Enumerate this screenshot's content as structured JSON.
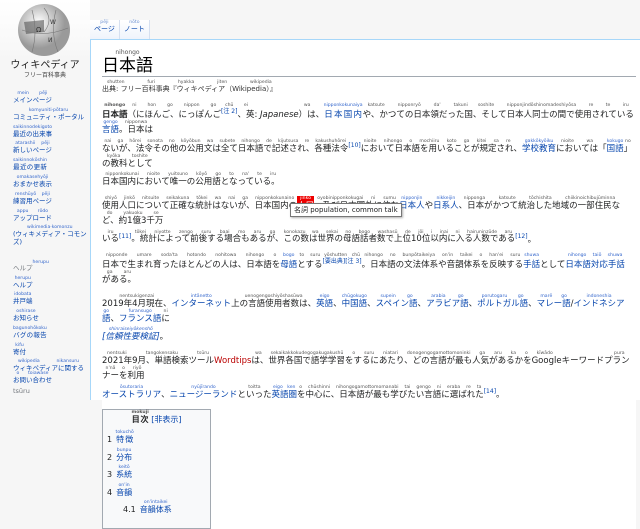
{
  "sidebar": {
    "logo_title": "ウィキペディア",
    "logo_sub": "フリー百科事典",
    "nav": [
      {
        "t": "メインページ",
        "r": "mein pēji"
      },
      {
        "t": "コミュニティ・ポータル",
        "r": "komyuniti·pōtaru"
      },
      {
        "t": "最近の出来事",
        "r": "saikinnodekigoto"
      },
      {
        "t": "新しいページ",
        "r": "atarashii pēji"
      },
      {
        "t": "最近の更新",
        "r": "saikinnokōshin"
      },
      {
        "t": "おまかせ表示",
        "r": "omakasehyōji"
      },
      {
        "t": "練習用ページ",
        "r": "renshūyō pēji"
      },
      {
        "t": "アップロード",
        "r": "appu rōdo"
      },
      {
        "t": "(ウィキメディア・コモンズ)",
        "r": "wikimedia·komonzu"
      }
    ],
    "help_heading": {
      "t": "ヘルプ",
      "r": "herupu"
    },
    "help": [
      {
        "t": "ヘルプ",
        "r": "herupu"
      },
      {
        "t": "井戸端",
        "r": "idobata"
      },
      {
        "t": "お知らせ",
        "r": "oshirase"
      },
      {
        "t": "バグの報告",
        "r": "bagunohōkoku"
      },
      {
        "t": "寄付",
        "r": "kifu"
      },
      {
        "t": "ウィキペディアに関するお問い合わせ",
        "r": "wikipedia nikansuru o toiawase"
      }
    ],
    "tools_heading": "tsūru"
  },
  "tabs": [
    {
      "t": "ページ",
      "r": "pēji"
    },
    {
      "t": "ノート",
      "r": "nōto"
    }
  ],
  "title": {
    "t": "日本語",
    "r": "nihongo"
  },
  "site_sub": [
    {
      "t": "出典: フリー百科事典『ウィキペディア（Wikipedia）』",
      "r": "shutten furi hyakka jiten wikipedia"
    }
  ],
  "paragraphs": [
    [
      [
        {
          "t": "日本語",
          "r": "nihongo",
          "c": "b"
        },
        {
          "t": "（にほんご、にっぽんご",
          "r": "ni hon go  nippon go"
        },
        {
          "t": "[注 2]",
          "r": "chū",
          "c": "s"
        },
        {
          "t": "、英",
          "r": "ei"
        },
        {
          "t": ": "
        },
        {
          "t": "Japanese",
          "c": "i"
        },
        {
          "t": "）は",
          "r": "wa"
        },
        {
          "t": "、"
        },
        {
          "t": "日本国内",
          "r": "nipponkokunaiya",
          "c": "l"
        },
        {
          "t": "や、かつての日本領だった国",
          "r": "katsute nipponryō da' takuni"
        },
        {
          "t": "、そして日本人同士の間で使用されている",
          "r": "soshite nipponjindōshinomadeshiyōsa re te iru"
        },
        {
          "t": "言語",
          "r": "gengo",
          "c": "l"
        },
        {
          "t": "。日本は",
          "r": "nipponwa"
        }
      ],
      [
        {
          "t": "ないが、法令その他の公用文は全て日本語で記述され、各種法令",
          "r": "nai ga hōrei sonota no kōyōbun wa subete nihongo de kijutsusa re kakushuhōrei"
        },
        {
          "t": "[10]",
          "c": "s"
        },
        {
          "t": "において日本語を用いることが規定され",
          "r": "nioite nihongo o mochiiru koto ga kitei sa re"
        },
        {
          "t": "、"
        },
        {
          "t": "学校教育",
          "r": "gakkōkyōiku",
          "c": "l"
        },
        {
          "t": "においては",
          "r": "nioite wa"
        },
        {
          "t": "「"
        },
        {
          "t": "国語",
          "r": "kokugo",
          "c": "l"
        },
        {
          "t": "」の教科として",
          "r": "nokyōka toshite"
        }
      ],
      [
        {
          "t": "日本国内において唯一の公用語となっている。",
          "r": "nipponkokunai nioite yuitsuno kōyō go to na' te iru"
        }
      ]
    ],
    [
      [
        {
          "t": "使用人口について正確な統計はないが、日本国内の",
          "r": "shiyō jinkō nitsuite seikakuna tōkei wa nai ga nipponkokunaino"
        },
        {
          "t": "人口",
          "r": "jinkō",
          "c": "h"
        },
        {
          "t": "、及び日本国外に住む",
          "r": "oyobinipponkokugai ni sumu"
        },
        {
          "t": "日本人",
          "r": "nipponjin",
          "c": "l"
        },
        {
          "t": "や"
        },
        {
          "t": "日系人",
          "r": "nikkeijin",
          "c": "l"
        },
        {
          "t": "、日本がかつて統治した地域の一部住民など、約1億3千万",
          "r": "nipponga katsute tōchishita chiikinoichibujūminnado yakuoku se"
        }
      ],
      [
        {
          "t": "いる",
          "r": "iru"
        },
        {
          "t": "[11]",
          "c": "s"
        },
        {
          "t": "。統計によって前後する場合もあるが、この数",
          "r": "tōkei niyotte zengo suru baai mo aru ga konokazu"
        },
        {
          "t": "は世界の母語話者数で上位10位以内に入る人数である",
          "r": "wa sekai no bogo washasū de jōi i inai ni hairuninzūde aru"
        },
        {
          "t": "[12]",
          "c": "s"
        },
        {
          "t": "。"
        }
      ]
    ],
    [
      [
        {
          "t": "日本で生まれ育ったほとんどの人は、日本語を",
          "r": "nipponde umare sodaꞌta hotondo nohitowa nihongo o"
        },
        {
          "t": "母語",
          "r": "bogo",
          "c": "l"
        },
        {
          "t": "とする",
          "r": "to suru"
        },
        {
          "t": "[要出典][注 3]",
          "r": "yōshutten chū",
          "c": "s"
        },
        {
          "t": "。日本語の文法体系や音韻体系を反映する",
          "r": "nihongo no bunpōtaikeiya on'in taikei o han'ei suru"
        },
        {
          "t": "手話",
          "r": "shuwa",
          "c": "l"
        },
        {
          "t": "として"
        },
        {
          "t": "日本語対応手話",
          "r": "nihongo taiō shuwa",
          "c": "l"
        },
        {
          "t": "がある。",
          "r": "ga aru"
        }
      ]
    ],
    [
      [
        {
          "t": "2019年4月現在、",
          "r": "nentsukigenzai"
        },
        {
          "t": "インターネット",
          "r": "intānetto",
          "c": "l"
        },
        {
          "t": "上の言語使用者数は、",
          "r": "uenogengoshiyōshasūwa"
        },
        {
          "t": "英語",
          "r": "eigo",
          "c": "l"
        },
        {
          "t": "、"
        },
        {
          "t": "中国語",
          "r": "chūgokugo",
          "c": "l"
        },
        {
          "t": "、"
        },
        {
          "t": "スペイン語",
          "r": "supein go",
          "c": "l"
        },
        {
          "t": "、"
        },
        {
          "t": "アラビア語",
          "r": "arabia go",
          "c": "l"
        },
        {
          "t": "、"
        },
        {
          "t": "ポルトガル語",
          "r": "porutogaru go",
          "c": "l"
        },
        {
          "t": "、"
        },
        {
          "t": "マレー語",
          "r": "marē go",
          "c": "l"
        },
        {
          "t": "/"
        },
        {
          "t": "インドネシア語",
          "r": "indoneshia go",
          "c": "l"
        },
        {
          "t": "、"
        },
        {
          "t": "フランス語",
          "r": "furansugo",
          "c": "l"
        },
        {
          "t": "に",
          "r": "ni"
        }
      ],
      [
        {
          "t": "[信頼性要検証]",
          "r": "shinraiseiyōkenshō",
          "c": "l i"
        },
        {
          "t": "。"
        }
      ]
    ],
    [
      [
        {
          "t": "2021年9月、単語検索ツール",
          "r": "nentsuki tangokensaku tsūru"
        },
        {
          "t": "Wordtips",
          "c": "red"
        },
        {
          "t": "は、世界各国で語学学習をするにあたり、どの言語が最も人気があるかを",
          "r": "wa sekaikakkokudegogakugakushū o suru niatari donogengogamottomoninki ga aru ka o"
        },
        {
          "t": "Googleキーワードプランナー",
          "r": "kīwādo puran'nā"
        },
        {
          "t": "を利用",
          "r": "o riyō"
        }
      ],
      [
        {
          "t": "オーストラリア",
          "r": "ōsutoraria",
          "c": "l"
        },
        {
          "t": "、"
        },
        {
          "t": "ニュージーランド",
          "r": "nyūjīrando",
          "c": "l"
        },
        {
          "t": "といった",
          "r": "toitta"
        },
        {
          "t": "英語圏",
          "r": "eigo ken",
          "c": "l"
        },
        {
          "t": "を中心に、日本語が最も学びたい言語に選ばれた",
          "r": "o chūshinni nihongogamottomomanabi tai gengo ni eraba re ta"
        },
        {
          "t": "[14]",
          "c": "s"
        },
        {
          "t": "。"
        }
      ]
    ]
  ],
  "tooltip": "名詞 population, common talk",
  "toc": {
    "title": {
      "t": "目次",
      "r": "mokuji"
    },
    "toggle": "[非表示]",
    "items": [
      {
        "n": "1",
        "t": "特徴",
        "r": "tokuchō"
      },
      {
        "n": "2",
        "t": "分布",
        "r": "bunpu"
      },
      {
        "n": "3",
        "t": "系統",
        "r": "keitō"
      },
      {
        "n": "4",
        "t": "音韻",
        "r": "on'in"
      },
      {
        "n": "4.1",
        "t": "音韻体系",
        "r": "on'intaikei"
      }
    ]
  }
}
